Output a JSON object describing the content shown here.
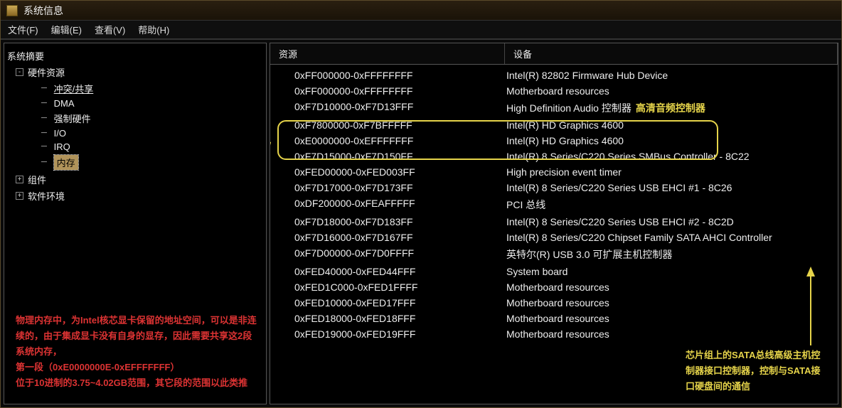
{
  "window": {
    "title": "系统信息"
  },
  "menubar": {
    "items": [
      "文件(F)",
      "编辑(E)",
      "查看(V)",
      "帮助(H)"
    ]
  },
  "tree": {
    "root": "系统摘要",
    "nodes": [
      {
        "label": "硬件资源",
        "expander": "-",
        "indent": 1,
        "underline": false
      },
      {
        "label": "冲突/共享",
        "indent": 2,
        "underline": true
      },
      {
        "label": "DMA",
        "indent": 2
      },
      {
        "label": "强制硬件",
        "indent": 2
      },
      {
        "label": "I/O",
        "indent": 2
      },
      {
        "label": "IRQ",
        "indent": 2
      },
      {
        "label": "内存",
        "indent": 2,
        "selected": true
      },
      {
        "label": "组件",
        "expander": "+",
        "indent": 1
      },
      {
        "label": "软件环境",
        "expander": "+",
        "indent": 1
      }
    ]
  },
  "table": {
    "headers": {
      "resource": "资源",
      "device": "设备"
    },
    "rows": [
      {
        "res": "0xFF000000-0xFFFFFFFF",
        "dev": "Intel(R) 82802 Firmware Hub Device"
      },
      {
        "res": "0xFF000000-0xFFFFFFFF",
        "dev": "Motherboard resources"
      },
      {
        "res": "0xF7D10000-0xF7D13FFF",
        "dev": "High Definition Audio 控制器",
        "extra": "高清音频控制器"
      },
      {
        "res": "0xF7800000-0xF7BFFFFF",
        "dev": "Intel(R) HD Graphics 4600"
      },
      {
        "res": "0xE0000000-0xEFFFFFFF",
        "dev": "Intel(R) HD Graphics 4600"
      },
      {
        "res": "0xF7D15000-0xF7D150FF",
        "dev": "Intel(R) 8 Series/C220 Series SMBus Controller - 8C22"
      },
      {
        "res": "0xFED00000-0xFED003FF",
        "dev": "High precision event timer"
      },
      {
        "res": "0xF7D17000-0xF7D173FF",
        "dev": "Intel(R) 8 Series/C220 Series USB EHCI #1 - 8C26"
      },
      {
        "res": "0xDF200000-0xFEAFFFFF",
        "dev": "PCI 总线"
      },
      {
        "res": "0xF7D18000-0xF7D183FF",
        "dev": "Intel(R) 8 Series/C220 Series USB EHCI #2 - 8C2D"
      },
      {
        "res": "0xF7D16000-0xF7D167FF",
        "dev": "Intel(R) 8 Series/C220 Chipset Family SATA AHCI Controller"
      },
      {
        "res": "0xF7D00000-0xF7D0FFFF",
        "dev": "英特尔(R) USB 3.0 可扩展主机控制器"
      },
      {
        "res": "0xFED40000-0xFED44FFF",
        "dev": "System board"
      },
      {
        "res": "0xFED1C000-0xFED1FFFF",
        "dev": "Motherboard resources"
      },
      {
        "res": "0xFED10000-0xFED17FFF",
        "dev": "Motherboard resources"
      },
      {
        "res": "0xFED18000-0xFED18FFF",
        "dev": "Motherboard resources"
      },
      {
        "res": "0xFED19000-0xFED19FFF",
        "dev": "Motherboard resources"
      }
    ]
  },
  "annotations": {
    "red_box": "物理内存中，为Intel核芯显卡保留的地址空间，可以是非连续的，由于集成显卡没有自身的显存，因此需要共享这2段系统内存，\n第一段（0xE0000000E-0xEFFFFFFF）\n位于10进制的3.75~4.02GB范围，其它段的范围以此类推",
    "yellow_sata": "芯片组上的SATA总线高级主机控制器接口控制器，控制与SATA接口硬盘间的通信"
  }
}
